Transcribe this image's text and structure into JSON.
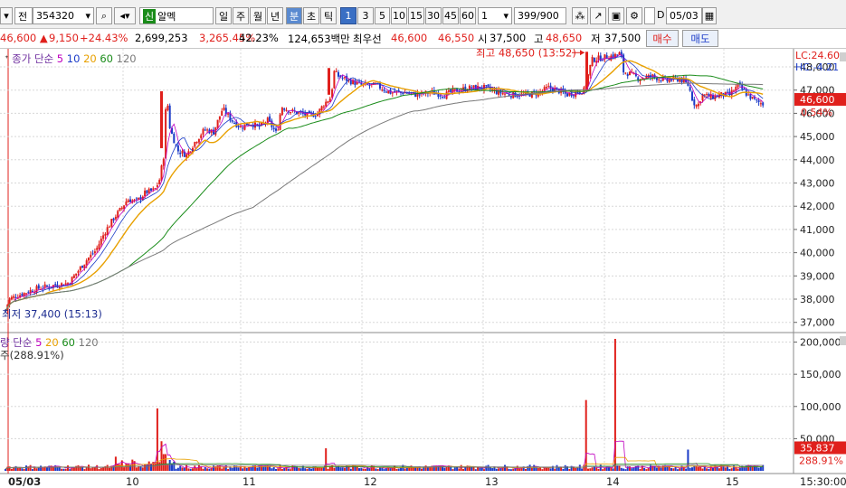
{
  "toolbar": {
    "market_label": "전",
    "stock_code": "354320",
    "credit_badge": "신",
    "stock_name": "알멕",
    "period_buttons": [
      "일",
      "주",
      "월",
      "년",
      "분",
      "초",
      "틱"
    ],
    "active_period": "분",
    "interval_buttons": [
      "1",
      "3",
      "5",
      "10",
      "15",
      "30",
      "45",
      "60"
    ],
    "active_interval": "1",
    "interval_value": "1",
    "count_value": "399",
    "count_max": "/900",
    "checkbox_label": "D",
    "date_value": "05/03"
  },
  "quote": {
    "price": "46,600",
    "change": "9,150",
    "change_pct": "+24.43%",
    "volume": "2,699,253",
    "volume_ratio": "3,265.45%",
    "turnover_pct": "42.23%",
    "amount": "124,653백만",
    "best_bid_label": "최우선",
    "best_ask": "46,600",
    "best_bid": "46,550",
    "open_label": "시",
    "open": "37,500",
    "high_label": "고",
    "high": "48,650",
    "low_label": "저",
    "low": "37,500",
    "buy_label": "매수",
    "sell_label": "매도"
  },
  "price_legend": {
    "prefix": "종가 단순",
    "ma": [
      "5",
      "10",
      "20",
      "60",
      "120"
    ]
  },
  "volume_legend": {
    "prefix": "량 단순",
    "ma": [
      "5",
      "20",
      "60",
      "120"
    ],
    "sub": "주(288.91%)"
  },
  "colors": {
    "up": "#e0201c",
    "down": "#1c3cc8",
    "ma5": "#c000c0",
    "ma10": "#1c3cc8",
    "ma20": "#e8a000",
    "ma60": "#1a8c1a",
    "ma120": "#7a7a7a",
    "grid": "#d8d8d8"
  },
  "chart_data": {
    "type": "candlestick",
    "x_labels": [
      "05/03",
      "10",
      "11",
      "12",
      "13",
      "14",
      "15",
      "15:30:00"
    ],
    "price_ylim": [
      36600,
      48700
    ],
    "price_ticks": [
      "48,000",
      "47,000",
      "46,000",
      "45,000",
      "44,000",
      "43,000",
      "42,000",
      "41,000",
      "40,000",
      "39,000",
      "38,000",
      "37,000"
    ],
    "lc_label": "LC:24.60",
    "hc_label": "HC:-4.21",
    "current_price": "46,600",
    "current_pct": "0.54%",
    "high_annotation": "최고 48,650 (13:52)",
    "low_annotation": "최저 37,400 (15:13)",
    "volume_ylim": [
      0,
      212000
    ],
    "volume_ticks": [
      "200,000",
      "150,000",
      "100,000",
      "50,000"
    ],
    "current_volume": "35,837",
    "current_volume_pct": "288.91%",
    "price_path": [
      [
        0,
        37500
      ],
      [
        4,
        38000
      ],
      [
        10,
        38100
      ],
      [
        20,
        38250
      ],
      [
        30,
        38400
      ],
      [
        40,
        38500
      ],
      [
        55,
        38600
      ],
      [
        70,
        38700
      ],
      [
        80,
        39200
      ],
      [
        90,
        39700
      ],
      [
        100,
        40100
      ],
      [
        110,
        40900
      ],
      [
        120,
        41500
      ],
      [
        128,
        41900
      ],
      [
        135,
        42300
      ],
      [
        145,
        42200
      ],
      [
        155,
        42600
      ],
      [
        165,
        42700
      ],
      [
        170,
        43100
      ],
      [
        175,
        44200
      ],
      [
        178,
        46900
      ],
      [
        182,
        45300
      ],
      [
        185,
        45000
      ],
      [
        190,
        44400
      ],
      [
        200,
        44200
      ],
      [
        210,
        44800
      ],
      [
        220,
        45300
      ],
      [
        230,
        45200
      ],
      [
        240,
        46200
      ],
      [
        250,
        45700
      ],
      [
        260,
        45400
      ],
      [
        270,
        45600
      ],
      [
        280,
        45400
      ],
      [
        290,
        45700
      ],
      [
        300,
        45100
      ],
      [
        305,
        46300
      ],
      [
        315,
        46100
      ],
      [
        325,
        46000
      ],
      [
        335,
        45900
      ],
      [
        345,
        46000
      ],
      [
        352,
        46400
      ],
      [
        360,
        46700
      ],
      [
        363,
        47800
      ],
      [
        368,
        47600
      ],
      [
        380,
        47400
      ],
      [
        395,
        47200
      ],
      [
        410,
        47200
      ],
      [
        425,
        46900
      ],
      [
        440,
        46900
      ],
      [
        455,
        46800
      ],
      [
        470,
        46900
      ],
      [
        485,
        46800
      ],
      [
        500,
        47000
      ],
      [
        515,
        47100
      ],
      [
        530,
        47100
      ],
      [
        545,
        46900
      ],
      [
        560,
        46800
      ],
      [
        575,
        46800
      ],
      [
        590,
        46900
      ],
      [
        600,
        47100
      ],
      [
        610,
        47000
      ],
      [
        620,
        46800
      ],
      [
        630,
        46900
      ],
      [
        640,
        47000
      ],
      [
        648,
        48300
      ],
      [
        660,
        48400
      ],
      [
        675,
        48500
      ],
      [
        680,
        48600
      ],
      [
        683,
        47800
      ],
      [
        690,
        47700
      ],
      [
        700,
        47500
      ],
      [
        715,
        47600
      ],
      [
        730,
        47400
      ],
      [
        745,
        47500
      ],
      [
        755,
        47200
      ],
      [
        760,
        46500
      ],
      [
        765,
        46300
      ],
      [
        770,
        46800
      ],
      [
        780,
        46700
      ],
      [
        790,
        46800
      ],
      [
        800,
        46800
      ],
      [
        810,
        47200
      ],
      [
        820,
        46800
      ],
      [
        830,
        46500
      ],
      [
        838,
        46400
      ],
      [
        845,
        46600
      ]
    ]
  }
}
